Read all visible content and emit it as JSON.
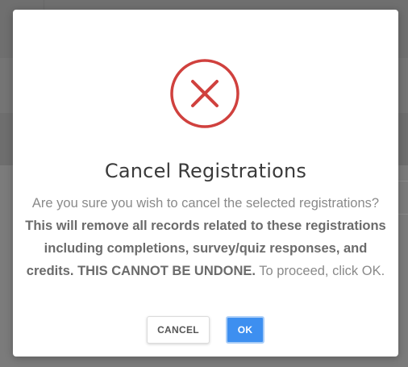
{
  "dialog": {
    "icon": "error-x-circle-icon",
    "icon_color": "#d0413e",
    "title": "Cancel Registrations",
    "message_part1": "Are you sure you wish to cancel the selected registrations? ",
    "message_bold": "This will remove all records related to these registrations including completions, survey/quiz responses, and credits. THIS CANNOT BE UNDONE.",
    "message_part2": " To proceed, click OK.",
    "cancel_label": "CANCEL",
    "ok_label": "OK",
    "ok_color": "#3d8ff0"
  }
}
